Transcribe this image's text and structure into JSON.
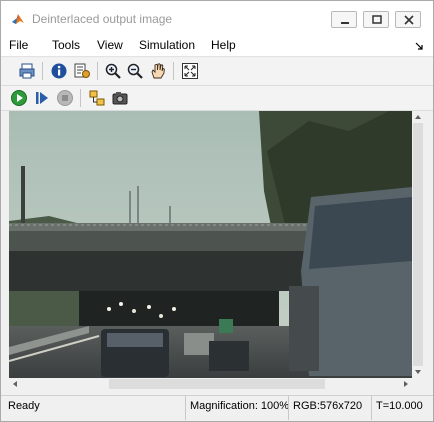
{
  "window": {
    "title": "Deinterlaced output image",
    "accent": "#0072bd"
  },
  "caption_buttons": [
    {
      "name": "minimize",
      "icon": "minimize-icon"
    },
    {
      "name": "maximize",
      "icon": "maximize-icon"
    },
    {
      "name": "close",
      "icon": "close-icon"
    }
  ],
  "menu": {
    "items": [
      "File",
      "Tools",
      "View",
      "Simulation",
      "Help"
    ],
    "overflow_icon": "dock-arrow-icon"
  },
  "toolbar1": {
    "buttons": [
      "print-icon",
      "info-icon",
      "properties-icon",
      "zoom-in-icon",
      "zoom-out-icon",
      "pan-hand-icon",
      "fit-to-view-icon"
    ]
  },
  "toolbar2": {
    "buttons": [
      "run-icon",
      "step-forward-icon",
      "stop-icon",
      "highlight-block-icon",
      "snapshot-camera-icon"
    ]
  },
  "status": {
    "state": "Ready",
    "magnification": "Magnification: 100%",
    "image_info": "RGB:576x720",
    "time": "T=10.000"
  }
}
